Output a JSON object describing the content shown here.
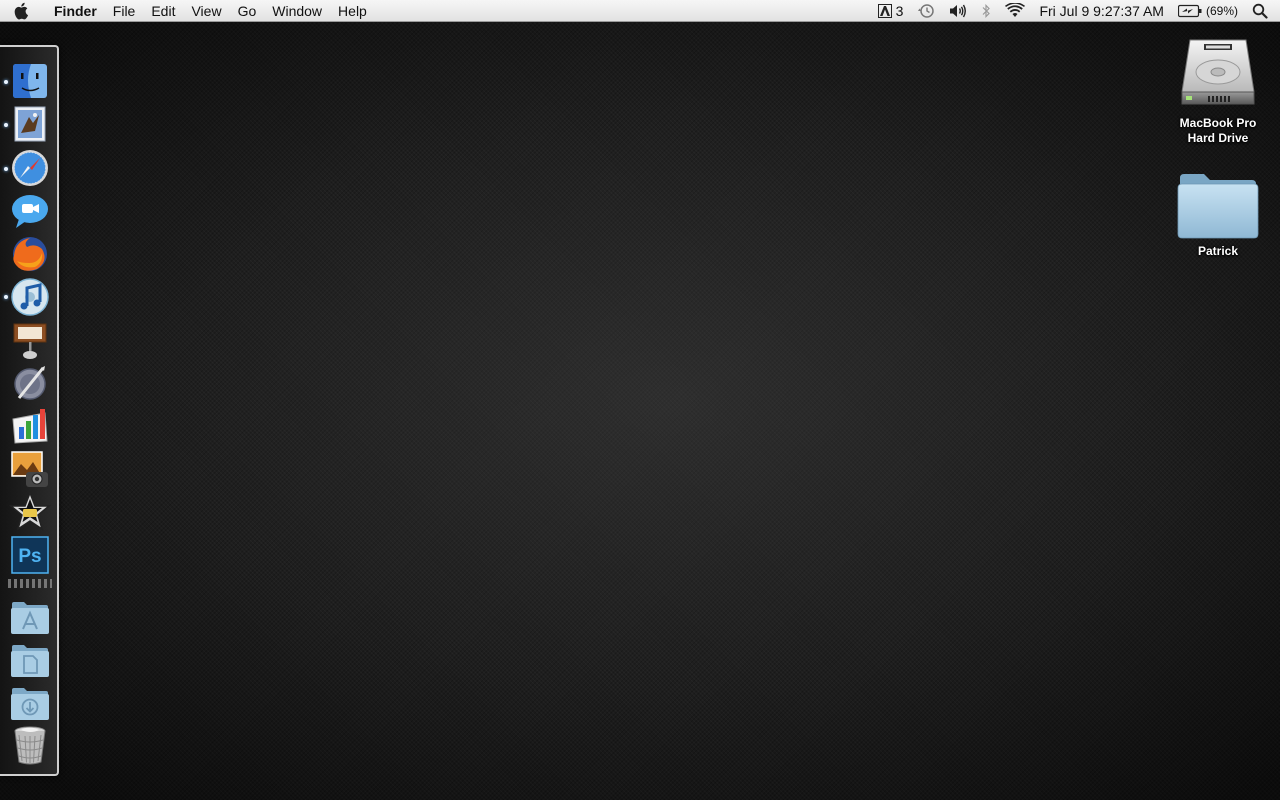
{
  "menubar": {
    "apple_icon": "apple-icon",
    "app_name": "Finder",
    "menus": [
      "File",
      "Edit",
      "View",
      "Go",
      "Window",
      "Help"
    ],
    "status": {
      "adobe_count": "3",
      "clock": "Fri Jul 9  9:27:37 AM",
      "battery_percent": "(69%)",
      "icons": [
        "adobe-updater-icon",
        "time-machine-icon",
        "volume-icon",
        "bluetooth-icon",
        "wifi-icon",
        "battery-icon",
        "spotlight-icon"
      ]
    }
  },
  "desktop": {
    "icons": [
      {
        "label_line1": "MacBook Pro",
        "label_line2": "Hard Drive",
        "icon": "hard-drive-icon"
      },
      {
        "label_line1": "Patrick",
        "icon": "folder-icon"
      }
    ]
  },
  "dock": {
    "items": [
      {
        "name": "finder",
        "icon": "finder-icon",
        "running": true
      },
      {
        "name": "mail",
        "icon": "mail-icon",
        "running": true
      },
      {
        "name": "safari",
        "icon": "safari-icon",
        "running": true
      },
      {
        "name": "ichat",
        "icon": "ichat-icon",
        "running": false
      },
      {
        "name": "firefox",
        "icon": "firefox-icon",
        "running": false
      },
      {
        "name": "itunes",
        "icon": "itunes-icon",
        "running": true
      },
      {
        "name": "keynote",
        "icon": "keynote-icon",
        "running": false
      },
      {
        "name": "script-editor",
        "icon": "script-editor-icon",
        "running": false
      },
      {
        "name": "numbers",
        "icon": "numbers-icon",
        "running": false
      },
      {
        "name": "iphoto",
        "icon": "iphoto-icon",
        "running": false
      },
      {
        "name": "imovie",
        "icon": "imovie-icon",
        "running": false
      },
      {
        "name": "photoshop",
        "icon": "photoshop-icon",
        "running": false,
        "label": "Ps"
      },
      {
        "name": "applications-stack",
        "icon": "applications-folder-icon"
      },
      {
        "name": "documents-stack",
        "icon": "documents-folder-icon"
      },
      {
        "name": "downloads-stack",
        "icon": "downloads-folder-icon"
      },
      {
        "name": "trash",
        "icon": "trash-icon"
      }
    ]
  }
}
